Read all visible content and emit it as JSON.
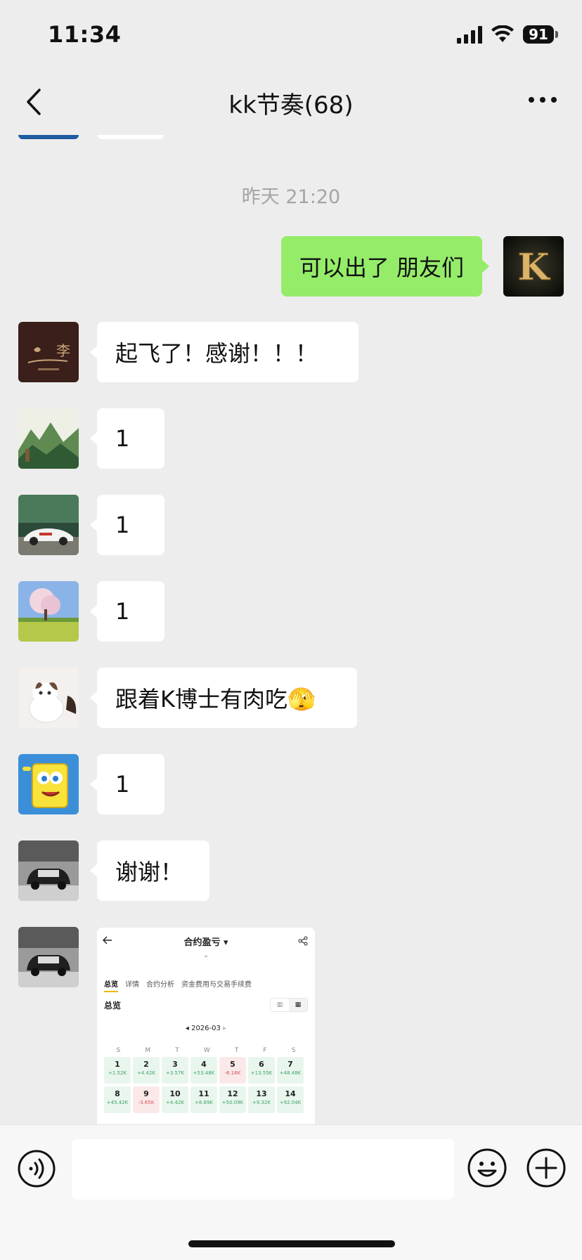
{
  "status": {
    "time": "11:34",
    "battery": "91"
  },
  "header": {
    "title": "kk节奏(68)"
  },
  "chat": {
    "timestamp": "昨天 21:20",
    "self_message": "可以出了 朋友们",
    "messages": [
      {
        "text": "起飞了！感谢！！！",
        "avatar": "calligraphy"
      },
      {
        "text": "1",
        "avatar": "landscape-painting"
      },
      {
        "text": "1",
        "avatar": "sports-car"
      },
      {
        "text": "1",
        "avatar": "tree-field"
      },
      {
        "text": "跟着K博士有肉吃🫣",
        "avatar": "kitten"
      },
      {
        "text": "1",
        "avatar": "spongebob"
      },
      {
        "text": "谢谢！",
        "avatar": "mini-car"
      }
    ],
    "self_avatar_letter": "K",
    "calligraphy_char": "李"
  },
  "screenshot": {
    "title": "合约盈亏",
    "tabs": [
      "总览",
      "详情",
      "合约分析",
      "资金费用与交易手续费"
    ],
    "section": "总览",
    "month": "2026-03",
    "weekdays": [
      "S",
      "M",
      "T",
      "W",
      "T",
      "F",
      "S"
    ],
    "days": [
      {
        "d": "1",
        "v": "+1.52K"
      },
      {
        "d": "2",
        "v": "+4.42K"
      },
      {
        "d": "3",
        "v": "+3.57K"
      },
      {
        "d": "4",
        "v": "+53.48K"
      },
      {
        "d": "5",
        "v": "-6.16K"
      },
      {
        "d": "6",
        "v": "+13.55K"
      },
      {
        "d": "7",
        "v": "+48.48K"
      },
      {
        "d": "8",
        "v": "+45.42K"
      },
      {
        "d": "9",
        "v": "-3.65K"
      },
      {
        "d": "10",
        "v": "+4.42K"
      },
      {
        "d": "11",
        "v": "+8.89K"
      },
      {
        "d": "12",
        "v": "+50.09K"
      },
      {
        "d": "13",
        "v": "+9.32K"
      },
      {
        "d": "14",
        "v": "+92.04K"
      }
    ]
  },
  "input": {
    "placeholder": ""
  }
}
